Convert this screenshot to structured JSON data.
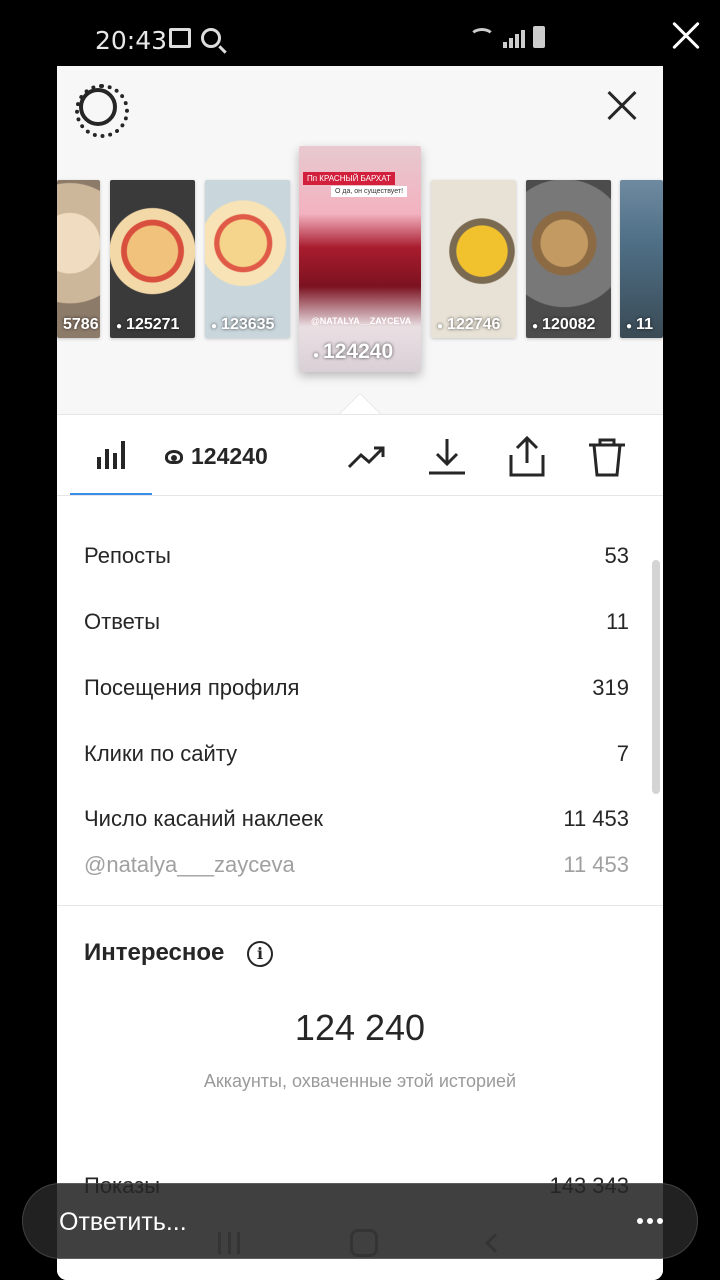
{
  "status_bar": {
    "time": "20:43"
  },
  "stories": [
    {
      "views": "5786"
    },
    {
      "views": "125271"
    },
    {
      "views": "123635"
    },
    {
      "views": "124240",
      "banner": "Пп КРАСНЫЙ БАРХАТ",
      "caption": "О да, он существует!",
      "handle": "@NATALYA__ZAYCEVA"
    },
    {
      "views": "122746"
    },
    {
      "views": "120082"
    },
    {
      "views": "11"
    }
  ],
  "toolbar": {
    "views": "124240"
  },
  "stats": [
    {
      "label": "Репосты",
      "value": "53"
    },
    {
      "label": "Ответы",
      "value": "11"
    },
    {
      "label": "Посещения профиля",
      "value": "319"
    },
    {
      "label": "Клики по сайту",
      "value": "7"
    },
    {
      "label": "Число касаний наклеек",
      "value": "11 453"
    },
    {
      "label": "@natalya___zayceva",
      "value": "11 453"
    }
  ],
  "interesting": {
    "title": "Интересное",
    "info": "i",
    "reach": "124 240",
    "reach_label": "Аккаунты, охваченные этой историей",
    "shows_label": "Показы",
    "shows_value": "143 343"
  },
  "reply": {
    "placeholder": "Ответить..."
  },
  "colors": {
    "accent": "#3a8ee8",
    "text": "#262626",
    "muted": "#9a9a9a"
  }
}
